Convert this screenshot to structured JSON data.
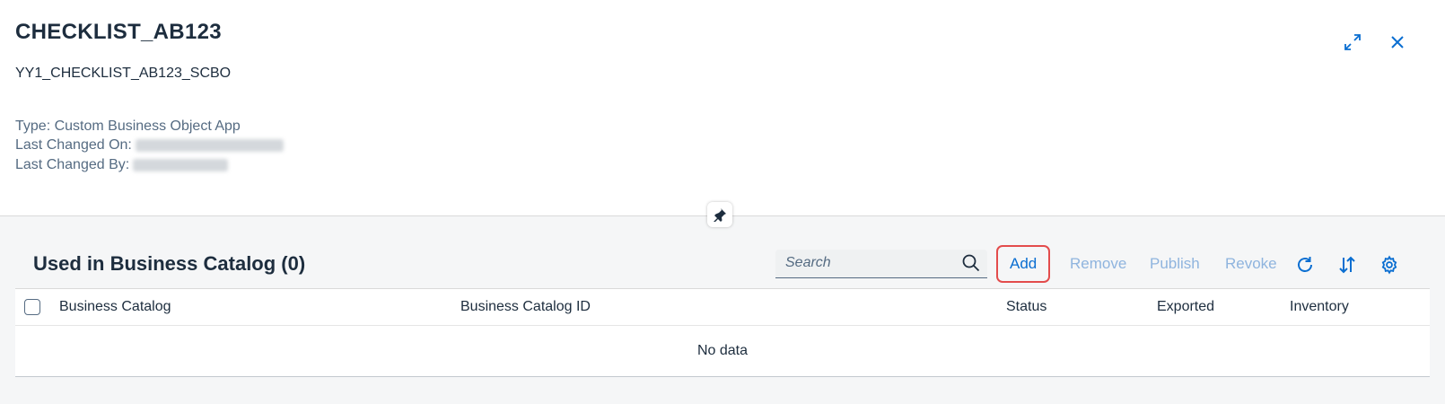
{
  "header": {
    "title": "CHECKLIST_AB123",
    "subtitle": "YY1_CHECKLIST_AB123_SCBO",
    "type_line": "Type: Custom Business Object App",
    "last_changed_on_label": "Last Changed On:",
    "last_changed_by_label": "Last Changed By:"
  },
  "icons": {
    "expand": "expand-icon",
    "close": "close-icon",
    "pin": "pin-icon",
    "search": "search-icon",
    "refresh": "refresh-icon",
    "sort": "sort-icon",
    "settings": "gear-icon"
  },
  "section": {
    "title": "Used in Business Catalog (0)"
  },
  "search": {
    "placeholder": "Search"
  },
  "toolbar": {
    "add_label": "Add",
    "remove_label": "Remove",
    "publish_label": "Publish",
    "revoke_label": "Revoke"
  },
  "table": {
    "columns": [
      "Business Catalog",
      "Business Catalog ID",
      "Status",
      "Exported",
      "Inventory"
    ],
    "empty_text": "No data"
  },
  "colors": {
    "accent": "#0a6ed1",
    "disabled": "#8fb4de",
    "highlight": "#e34c4c",
    "text": "#1d2d3e"
  }
}
